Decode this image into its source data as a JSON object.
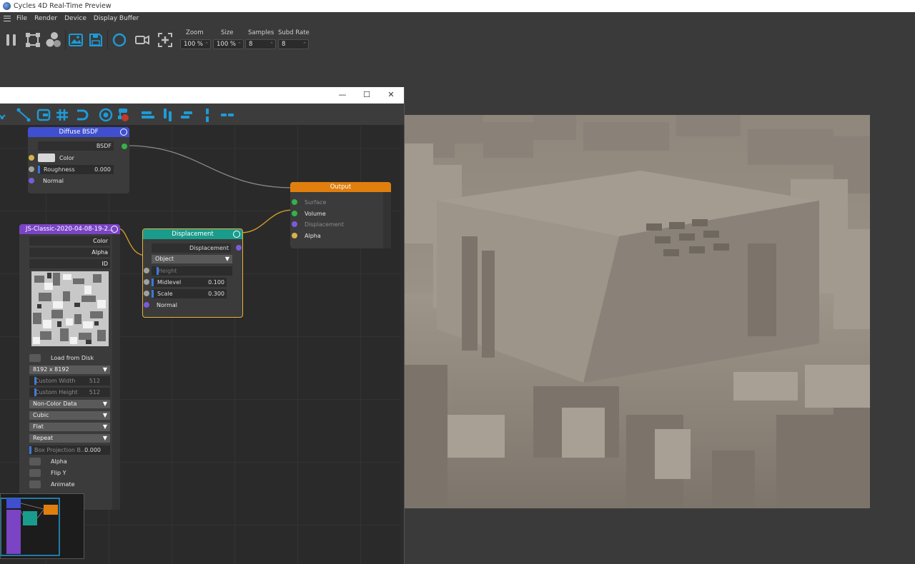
{
  "window": {
    "title": "Cycles 4D Real-Time Preview"
  },
  "menu": [
    "File",
    "Render",
    "Device",
    "Display Buffer"
  ],
  "toolbar": {
    "icons": [
      "pause-icon",
      "region-icon",
      "material-balls-icon",
      "image-icon",
      "save-icon",
      "circle-icon",
      "camera-icon",
      "add-target-icon"
    ],
    "zoom": {
      "label": "Zoom",
      "value": "100 %"
    },
    "size": {
      "label": "Size",
      "value": "100 %"
    },
    "samples": {
      "label": "Samples",
      "value": "8"
    },
    "subd_rate": {
      "label": "Subd Rate",
      "value": "8"
    }
  },
  "node_window": {
    "controls": {
      "minimize": "—",
      "maximize": "☐",
      "close": "✕"
    }
  },
  "nodes": {
    "diffuse": {
      "title": "Diffuse BSDF",
      "output": "BSDF",
      "color_label": "Color",
      "roughness_label": "Roughness",
      "roughness_value": "0.000",
      "normal_label": "Normal"
    },
    "output": {
      "title": "Output",
      "surface": "Surface",
      "volume": "Volume",
      "displacement": "Displacement",
      "alpha": "Alpha"
    },
    "image": {
      "title": "JS-Classic-2020-04-08-19-2...",
      "out_color": "Color",
      "out_alpha": "Alpha",
      "out_id": "ID",
      "load_label": "Load from Disk",
      "resolution": "8192 x 8192",
      "custom_width_label": "Custom Width",
      "custom_width_value": "512",
      "custom_height_label": "Custom Height",
      "custom_height_value": "512",
      "color_space": "Non-Color Data",
      "interpolation": "Cubic",
      "projection": "Flat",
      "extension": "Repeat",
      "box_blend_label": "Box Projection B...",
      "box_blend_value": "0.000",
      "alpha_label": "Alpha",
      "flipy_label": "Flip Y",
      "animate_label": "Animate"
    },
    "displacement": {
      "title": "Displacement",
      "output": "Displacement",
      "space": "Object",
      "height_label": "Height",
      "midlevel_label": "Midlevel",
      "midlevel_value": "0.100",
      "scale_label": "Scale",
      "scale_value": "0.300",
      "normal_label": "Normal"
    }
  },
  "colors": {
    "accent_blue": "#1e9bd7",
    "diffuse_header": "#3f4fd0",
    "output_header": "#e07f0e",
    "image_header": "#7a44c4",
    "displacement_header": "#1a9c8c",
    "selection_outline": "#e8b23a"
  }
}
